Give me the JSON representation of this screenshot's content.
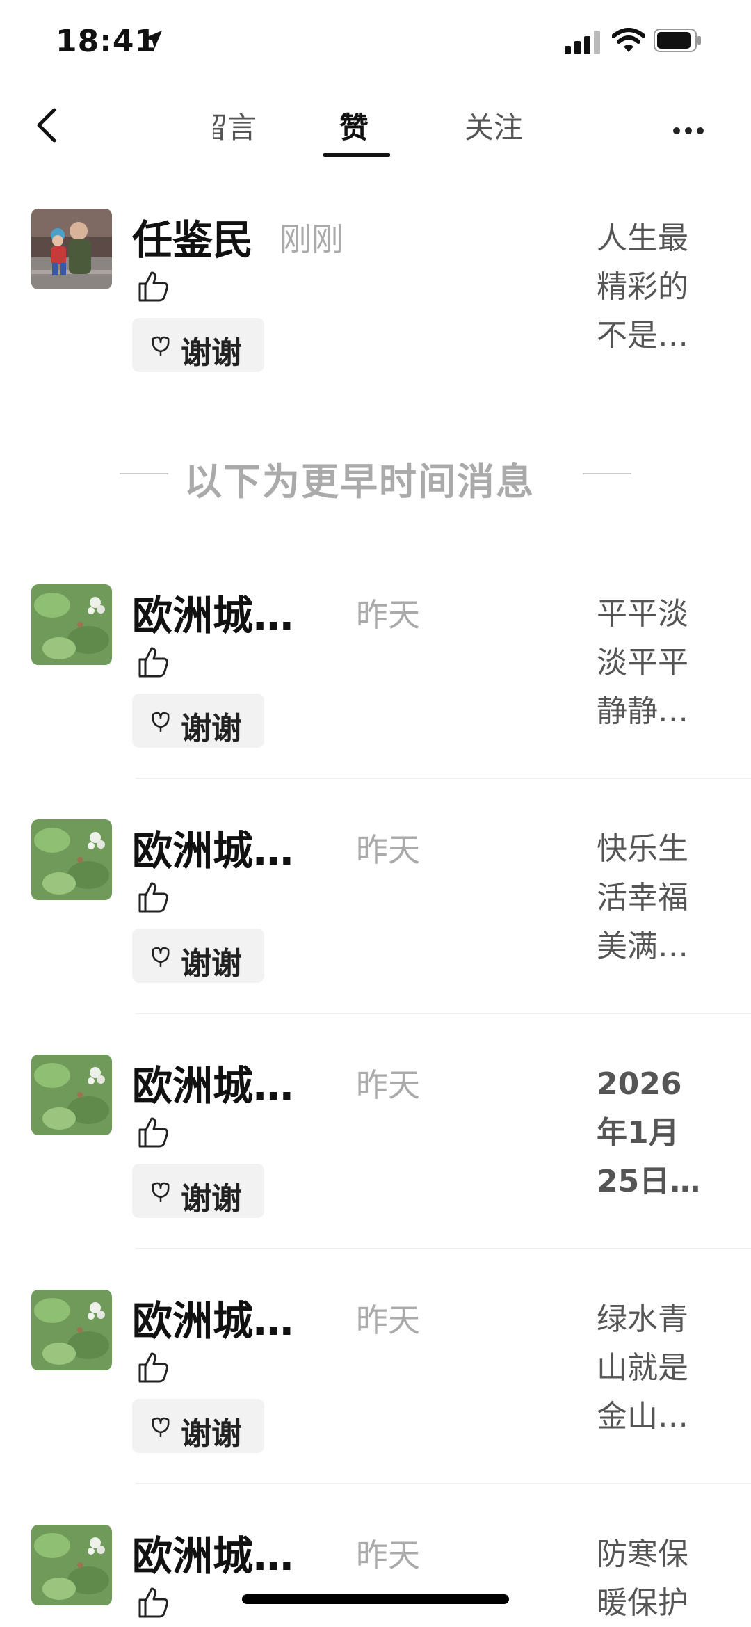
{
  "status_bar": {
    "time": "18:41"
  },
  "nav": {
    "tabs": [
      {
        "label": "留言"
      },
      {
        "label": "赞"
      },
      {
        "label": "关注"
      }
    ]
  },
  "top_item": {
    "name": "任鉴民",
    "time": "刚刚",
    "thanks_label": "谢谢",
    "preview_lines": [
      "人生最",
      "精彩的",
      "不是…"
    ]
  },
  "earlier_divider": "以下为更早时间消息",
  "items": [
    {
      "name": "欧洲城…",
      "time": "昨天",
      "thanks_label": "谢谢",
      "preview_lines": [
        "平平淡",
        "淡平平",
        "静静…"
      ]
    },
    {
      "name": "欧洲城…",
      "time": "昨天",
      "thanks_label": "谢谢",
      "preview_lines": [
        "快乐生",
        "活幸福",
        "美满…"
      ]
    },
    {
      "name": "欧洲城…",
      "time": "昨天",
      "thanks_label": "谢谢",
      "preview_lines": [
        "2026",
        "年1月",
        "25日…"
      ]
    },
    {
      "name": "欧洲城…",
      "time": "昨天",
      "thanks_label": "谢谢",
      "preview_lines": [
        "绿水青",
        "山就是",
        "金山…"
      ]
    },
    {
      "name": "欧洲城…",
      "time": "昨天",
      "thanks_label": "",
      "preview_lines": [
        "防寒保",
        "暖保护"
      ]
    }
  ]
}
